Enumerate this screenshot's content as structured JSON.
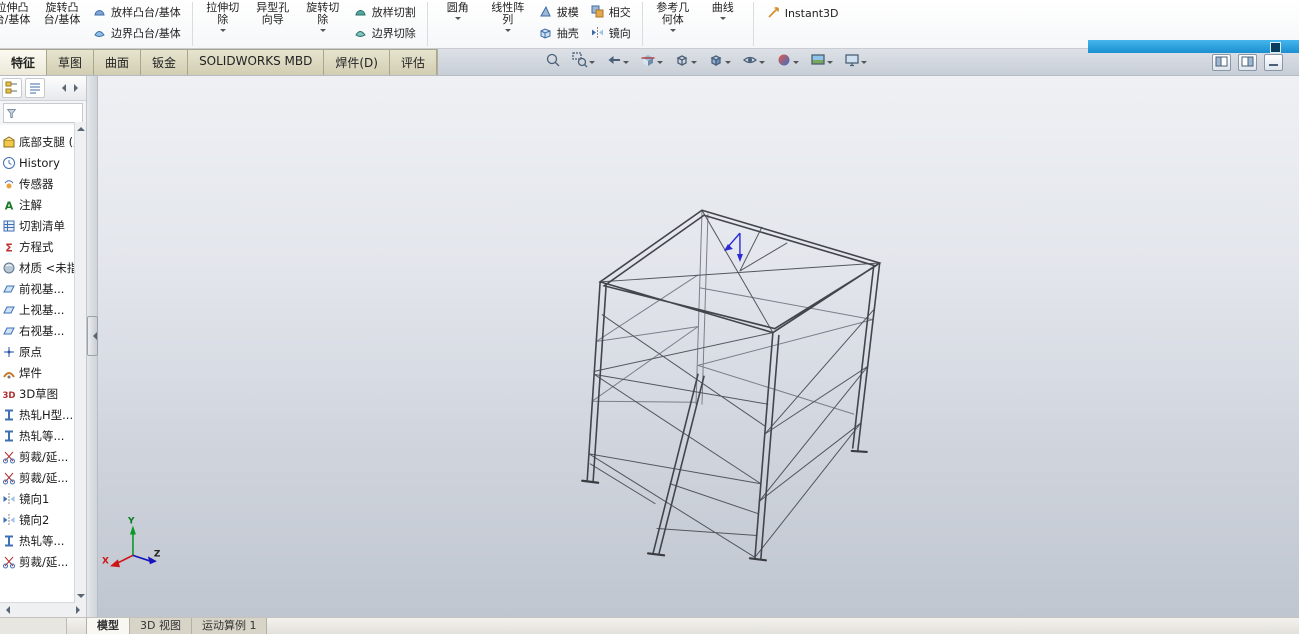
{
  "colors": {
    "accent_blue": "#2f9fdf",
    "tab_tan": "#d8d4bd",
    "viewport_top": "#eef0f4",
    "viewport_bottom": "#c0c6d0",
    "model_stroke": "#43454c",
    "triad_x_color": "#cc1515",
    "triad_y_color": "#0a9a28",
    "triad_z_color": "#1515bb"
  },
  "ribbon": {
    "groups": [
      {
        "type": "big",
        "label": "拉伸凸台/基体",
        "icon": "extrude-boss"
      },
      {
        "type": "big",
        "label": "旋转凸台/基体",
        "icon": "revolve-boss"
      },
      {
        "type": "stack",
        "items": [
          {
            "label": "放样凸台/基体",
            "icon": "loft-boss"
          },
          {
            "label": "边界凸台/基体",
            "icon": "boundary-boss"
          }
        ],
        "sepAfter": true
      },
      {
        "type": "big",
        "label": "拉伸切除",
        "icon": "extrude-cut",
        "caret": true
      },
      {
        "type": "big",
        "label": "异型孔向导",
        "icon": "hole-wizard"
      },
      {
        "type": "big",
        "label": "旋转切除",
        "icon": "revolve-cut",
        "caret": true
      },
      {
        "type": "stack",
        "items": [
          {
            "label": "放样切割",
            "icon": "loft-cut"
          },
          {
            "label": "边界切除",
            "icon": "boundary-cut"
          }
        ],
        "sepAfter": true
      },
      {
        "type": "big",
        "label": "圆角",
        "icon": "fillet",
        "caret": true
      },
      {
        "type": "big",
        "label": "线性阵列",
        "icon": "linear-pattern",
        "caret": true
      },
      {
        "type": "stack",
        "items": [
          {
            "label": "拔模",
            "icon": "draft"
          },
          {
            "label": "抽壳",
            "icon": "shell"
          }
        ]
      },
      {
        "type": "stack",
        "items": [
          {
            "label": "相交",
            "icon": "intersect"
          },
          {
            "label": "镜向",
            "icon": "mirror"
          }
        ],
        "sepAfter": true
      },
      {
        "type": "big",
        "label": "参考几何体",
        "icon": "reference-geometry",
        "caret": true
      },
      {
        "type": "big",
        "label": "曲线",
        "icon": "curves",
        "caret": true,
        "sepAfter": true
      },
      {
        "type": "toggle",
        "label": "Instant3D",
        "icon": "instant3d"
      }
    ]
  },
  "tabs": [
    {
      "label": "特征",
      "active": true
    },
    {
      "label": "草图"
    },
    {
      "label": "曲面"
    },
    {
      "label": "钣金"
    },
    {
      "label": "SOLIDWORKS MBD"
    },
    {
      "label": "焊件(D)"
    },
    {
      "label": "评估"
    }
  ],
  "headsup": [
    {
      "name": "zoom-to-fit"
    },
    {
      "name": "zoom-to-area",
      "caret": true
    },
    {
      "name": "previous-view",
      "caret": true
    },
    {
      "name": "section-view",
      "caret": true
    },
    {
      "name": "view-orientation",
      "caret": true
    },
    {
      "name": "display-style",
      "caret": true
    },
    {
      "name": "hide-show-items",
      "caret": true
    },
    {
      "name": "edit-appearance",
      "caret": true
    },
    {
      "name": "apply-scene",
      "caret": true
    },
    {
      "name": "view-settings",
      "caret": true
    }
  ],
  "winbtns": [
    {
      "name": "pane-left"
    },
    {
      "name": "pane-right"
    },
    {
      "name": "minimize"
    }
  ],
  "feature_tree": {
    "items": [
      {
        "label": "底部支腿 (默认)",
        "icon": "part",
        "root": true
      },
      {
        "label": "History",
        "icon": "history"
      },
      {
        "label": "传感器",
        "icon": "sensors"
      },
      {
        "label": "注解",
        "icon": "annotations"
      },
      {
        "label": "切割清单",
        "icon": "cutlist"
      },
      {
        "label": "方程式",
        "icon": "equations"
      },
      {
        "label": "材质 <未指定>",
        "icon": "material"
      },
      {
        "label": "前视基...",
        "icon": "plane"
      },
      {
        "label": "上视基...",
        "icon": "plane"
      },
      {
        "label": "右视基...",
        "icon": "plane"
      },
      {
        "label": "原点",
        "icon": "origin"
      },
      {
        "label": "焊件",
        "icon": "weldment"
      },
      {
        "label": "3D草图",
        "icon": "sketch3d"
      },
      {
        "label": "热轧H型...",
        "icon": "profile"
      },
      {
        "label": "热轧等...",
        "icon": "profile"
      },
      {
        "label": "剪裁/延...",
        "icon": "trim"
      },
      {
        "label": "剪裁/延...",
        "icon": "trim"
      },
      {
        "label": "镜向1",
        "icon": "mirror"
      },
      {
        "label": "镜向2",
        "icon": "mirror"
      },
      {
        "label": "热轧等...",
        "icon": "profile"
      },
      {
        "label": "剪裁/延...",
        "icon": "trim"
      }
    ]
  },
  "statusbar": {
    "tabs": [
      {
        "label": "模型",
        "active": true
      },
      {
        "label": "3D 视图"
      },
      {
        "label": "运动算例 1"
      }
    ]
  },
  "triad": {
    "x": "X",
    "y": "Y",
    "z": "Z"
  }
}
